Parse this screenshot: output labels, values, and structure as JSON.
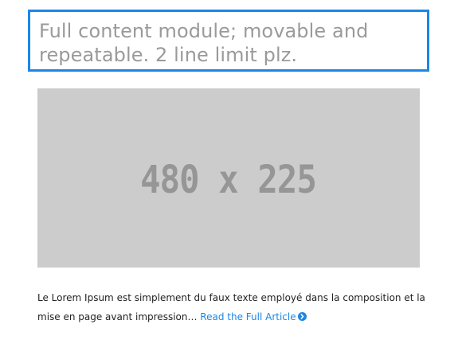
{
  "module": {
    "title": "Full content module; movable and repeatable. 2 line limit plz.",
    "title_border_color": "#1a87e6",
    "image": {
      "placeholder_text": "480 x 225",
      "background_color": "#cccccc",
      "text_color": "#969696"
    },
    "excerpt": {
      "text": "Le Lorem Ipsum est simplement du faux texte employé dans la composition et la mise en page avant impression… ",
      "read_more_label": "Read the Full Article",
      "read_more_icon": "chevron-circle-right-icon",
      "link_color": "#1a87e6"
    }
  }
}
